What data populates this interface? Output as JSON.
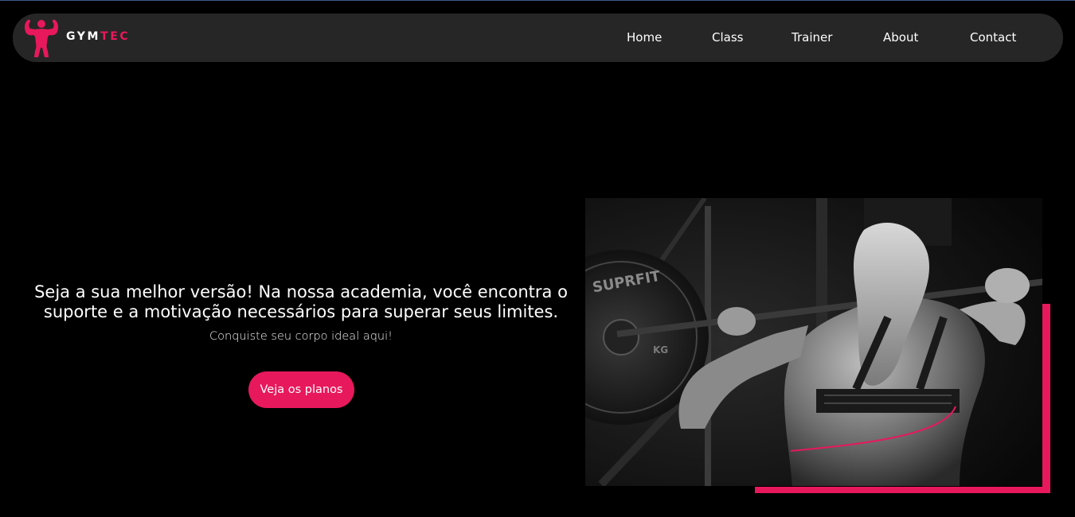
{
  "brand": {
    "prefix": "GYM",
    "accent": "TEC",
    "logo_icon": "bodybuilder-flex-icon",
    "accent_color": "#e8185c"
  },
  "nav": {
    "items": [
      {
        "label": "Home"
      },
      {
        "label": "Class"
      },
      {
        "label": "Trainer"
      },
      {
        "label": "About"
      },
      {
        "label": "Contact"
      }
    ]
  },
  "hero": {
    "headline": "Seja a sua melhor versão! Na nossa academia, você encontra o suporte e a motivação necessários para superar seus limites.",
    "subtitle": "Conquiste seu corpo ideal aqui!",
    "cta_label": "Veja os planos",
    "image": {
      "description_icon": "woman-barbell-squat-photo",
      "plate_text": "SUPRFIT",
      "plate_text_small": "KG"
    }
  },
  "colors": {
    "background": "#000000",
    "navbar": "#262626",
    "accent": "#e8185c",
    "text": "#ffffff"
  }
}
